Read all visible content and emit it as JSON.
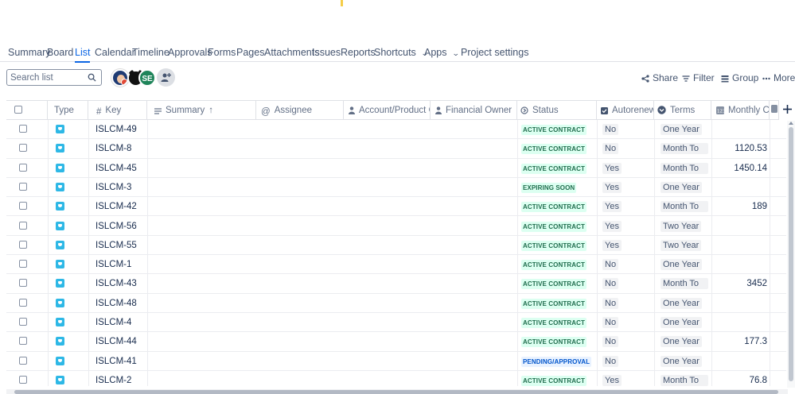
{
  "tabs": [
    {
      "label": "Summary"
    },
    {
      "label": "Board"
    },
    {
      "label": "List"
    },
    {
      "label": "Calendar"
    },
    {
      "label": "Timeline"
    },
    {
      "label": "Approvals"
    },
    {
      "label": "Forms"
    },
    {
      "label": "Pages"
    },
    {
      "label": "Attachments"
    },
    {
      "label": "Issues"
    },
    {
      "label": "Reports"
    },
    {
      "label": "Shortcuts"
    },
    {
      "label": "Apps"
    },
    {
      "label": "Project settings"
    }
  ],
  "toolbar": {
    "search_placeholder": "Search list",
    "avatar_initials": "SE",
    "share": "Share",
    "filter": "Filter",
    "group": "Group",
    "more": "More"
  },
  "columns": {
    "type": "Type",
    "key": "Key",
    "summary": "Summary",
    "assignee": "Assignee",
    "account_owner": "Account/Product Owner",
    "financial_owner": "Financial Owner",
    "status": "Status",
    "autorenewal": "Autorenewal",
    "terms": "Terms",
    "monthly": "Monthly Ch..."
  },
  "rows": [
    {
      "key": "ISLCM-49",
      "status": "ACTIVE CONTRACT",
      "autorenewal": "No",
      "terms": "One Year",
      "monthly": ""
    },
    {
      "key": "ISLCM-8",
      "status": "ACTIVE CONTRACT",
      "autorenewal": "No",
      "terms": "Month To M...",
      "monthly": "1120.53"
    },
    {
      "key": "ISLCM-45",
      "status": "ACTIVE CONTRACT",
      "autorenewal": "Yes",
      "terms": "Month To M...",
      "monthly": "1450.14"
    },
    {
      "key": "ISLCM-3",
      "status": "EXPIRING SOON",
      "autorenewal": "Yes",
      "terms": "One Year",
      "monthly": ""
    },
    {
      "key": "ISLCM-42",
      "status": "ACTIVE CONTRACT",
      "autorenewal": "Yes",
      "terms": "Month To M...",
      "monthly": "189"
    },
    {
      "key": "ISLCM-56",
      "status": "ACTIVE CONTRACT",
      "autorenewal": "Yes",
      "terms": "Two Year",
      "monthly": ""
    },
    {
      "key": "ISLCM-55",
      "status": "ACTIVE CONTRACT",
      "autorenewal": "Yes",
      "terms": "Two Year",
      "monthly": ""
    },
    {
      "key": "ISLCM-1",
      "status": "ACTIVE CONTRACT",
      "autorenewal": "No",
      "terms": "One Year",
      "monthly": ""
    },
    {
      "key": "ISLCM-43",
      "status": "ACTIVE CONTRACT",
      "autorenewal": "No",
      "terms": "Month To M...",
      "monthly": "3452"
    },
    {
      "key": "ISLCM-48",
      "status": "ACTIVE CONTRACT",
      "autorenewal": "No",
      "terms": "One Year",
      "monthly": ""
    },
    {
      "key": "ISLCM-4",
      "status": "ACTIVE CONTRACT",
      "autorenewal": "No",
      "terms": "One Year",
      "monthly": ""
    },
    {
      "key": "ISLCM-44",
      "status": "ACTIVE CONTRACT",
      "autorenewal": "No",
      "terms": "One Year",
      "monthly": "177.3"
    },
    {
      "key": "ISLCM-41",
      "status": "PENDING/APPROVAL",
      "autorenewal": "No",
      "terms": "One Year",
      "monthly": ""
    },
    {
      "key": "ISLCM-2",
      "status": "ACTIVE CONTRACT",
      "autorenewal": "Yes",
      "terms": "Month To M...",
      "monthly": "76.8"
    }
  ],
  "colors": {
    "accent": "#0c66e4",
    "status_green_text": "#216e4e",
    "status_green_bg": "#dcfff1",
    "status_blue_text": "#0055cc",
    "status_blue_bg": "#e9f2ff",
    "type_icon": "#2eb8e6"
  }
}
